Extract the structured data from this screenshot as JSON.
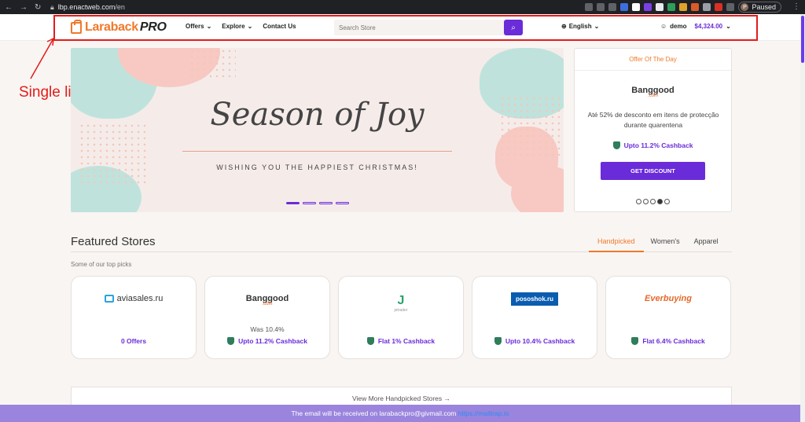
{
  "browser": {
    "url_host": "lbp.enactweb.com",
    "url_path": "/en",
    "profile_initial": "P",
    "profile_status": "Paused"
  },
  "header": {
    "logo_text": "Laraback",
    "logo_pro": "PRO",
    "nav": [
      {
        "label": "Offers"
      },
      {
        "label": "Explore"
      },
      {
        "label": "Contact Us"
      }
    ],
    "search_placeholder": "Search Store",
    "language": "English",
    "user_name": "demo",
    "balance": "$4,324.00"
  },
  "annotation": {
    "text": "Single line header",
    "color": "#e31b1b"
  },
  "hero": {
    "title": "Season of Joy",
    "subtitle": "WISHING YOU THE HAPPIEST CHRISTMAS!",
    "slide_count": 4,
    "active_slide": 1
  },
  "offer_of_day": {
    "heading": "Offer Of The Day",
    "brand": "Banggood",
    "brand_sub": ".com",
    "description": "Até 52% de desconto em itens de protecção durante quarentena",
    "cashback": "Upto 11.2% Cashback",
    "button": "GET DISCOUNT",
    "dot_count": 5,
    "active_dot": 4
  },
  "featured": {
    "title": "Featured Stores",
    "subtitle": "Some of our top picks",
    "tabs": [
      {
        "label": "Handpicked",
        "active": true
      },
      {
        "label": "Women's",
        "active": false
      },
      {
        "label": "Apparel",
        "active": false
      }
    ],
    "stores": [
      {
        "name": "aviasales.ru",
        "was": "",
        "cashback": "0 Offers"
      },
      {
        "name": "Banggood",
        "name_sub": ".com",
        "was": "Was 10.4%",
        "cashback": "Upto 11.2% Cashback"
      },
      {
        "name": "jetrader",
        "was": "",
        "cashback": "Flat 1% Cashback"
      },
      {
        "name": "pososhok.ru",
        "was": "",
        "cashback": "Upto 10.4% Cashback"
      },
      {
        "name": "Everbuying",
        "was": "",
        "cashback": "Flat 6.4% Cashback"
      }
    ],
    "view_more": "View More Handpicked Stores →"
  },
  "footer": {
    "text": "The email will be received on larabackpro@givmail.com",
    "link": "https://mailtrap.io"
  },
  "colors": {
    "primary": "#6a2bd9",
    "accent": "#f0792a",
    "page_bg": "#f9f5f2"
  }
}
